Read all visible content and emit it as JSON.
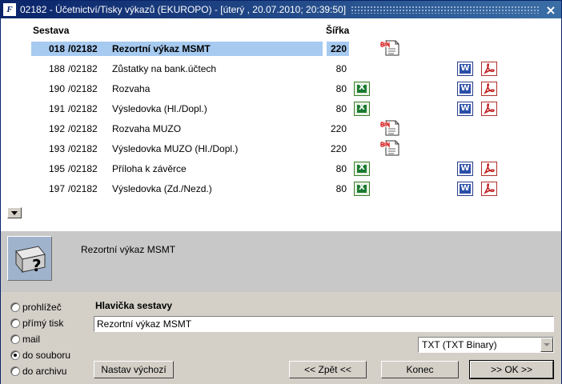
{
  "window": {
    "title": "02182 - Účetnictví/Tisky výkazů (EKUROPO) - [úterý  , 20.07.2010; 20:39:50]",
    "app_icon": "F",
    "close_glyph": "×"
  },
  "list": {
    "columns": {
      "sestava": "Sestava",
      "sirka": "Šířka"
    },
    "rows": [
      {
        "num": "018",
        "code": "/02182",
        "name": "Rezortní výkaz MSMT",
        "width": "220",
        "icons": [
          "bin"
        ],
        "selected": true
      },
      {
        "num": "188",
        "code": "/02182",
        "name": "Zůstatky na bank.účtech",
        "width": "80",
        "icons": [
          "word",
          "pdf"
        ]
      },
      {
        "num": "190",
        "code": "/02182",
        "name": "Rozvaha",
        "width": "80",
        "icons": [
          "excel",
          "word",
          "pdf"
        ]
      },
      {
        "num": "191",
        "code": "/02182",
        "name": "Výsledovka (Hl./Dopl.)",
        "width": "80",
        "icons": [
          "excel",
          "word",
          "pdf"
        ]
      },
      {
        "num": "192",
        "code": "/02182",
        "name": "Rozvaha MUZO",
        "width": "220",
        "icons": [
          "bin"
        ]
      },
      {
        "num": "193",
        "code": "/02182",
        "name": "Výsledovka MUZO (Hl./Dopl.)",
        "width": "220",
        "icons": [
          "bin"
        ]
      },
      {
        "num": "195",
        "code": "/02182",
        "name": "Příloha k závěrce",
        "width": "80",
        "icons": [
          "excel",
          "word",
          "pdf"
        ]
      },
      {
        "num": "197",
        "code": "/02182",
        "name": "Výsledovka (Zd./Nezd.)",
        "width": "80",
        "icons": [
          "excel",
          "word",
          "pdf"
        ]
      }
    ]
  },
  "description": {
    "text": "Rezortní výkaz MSMT"
  },
  "output": {
    "options": [
      {
        "label": "prohlížeč",
        "checked": false
      },
      {
        "label": "přímý tisk",
        "checked": false
      },
      {
        "label": "mail",
        "checked": false
      },
      {
        "label": "do souboru",
        "checked": true
      },
      {
        "label": "do archivu",
        "checked": false
      }
    ]
  },
  "header": {
    "label": "Hlavička sestavy",
    "value": "Rezortní výkaz MSMT"
  },
  "format": {
    "selected": "TXT (TXT Binary)"
  },
  "buttons": {
    "default": "Nastav výchozí",
    "back": "<< Zpět <<",
    "end": "Konec",
    "ok": ">> OK >>"
  },
  "colors": {
    "title_bar": "#0a246a",
    "selection": "#a6caf0",
    "panel": "#c8c8c8",
    "dialog": "#d4d0c8"
  }
}
